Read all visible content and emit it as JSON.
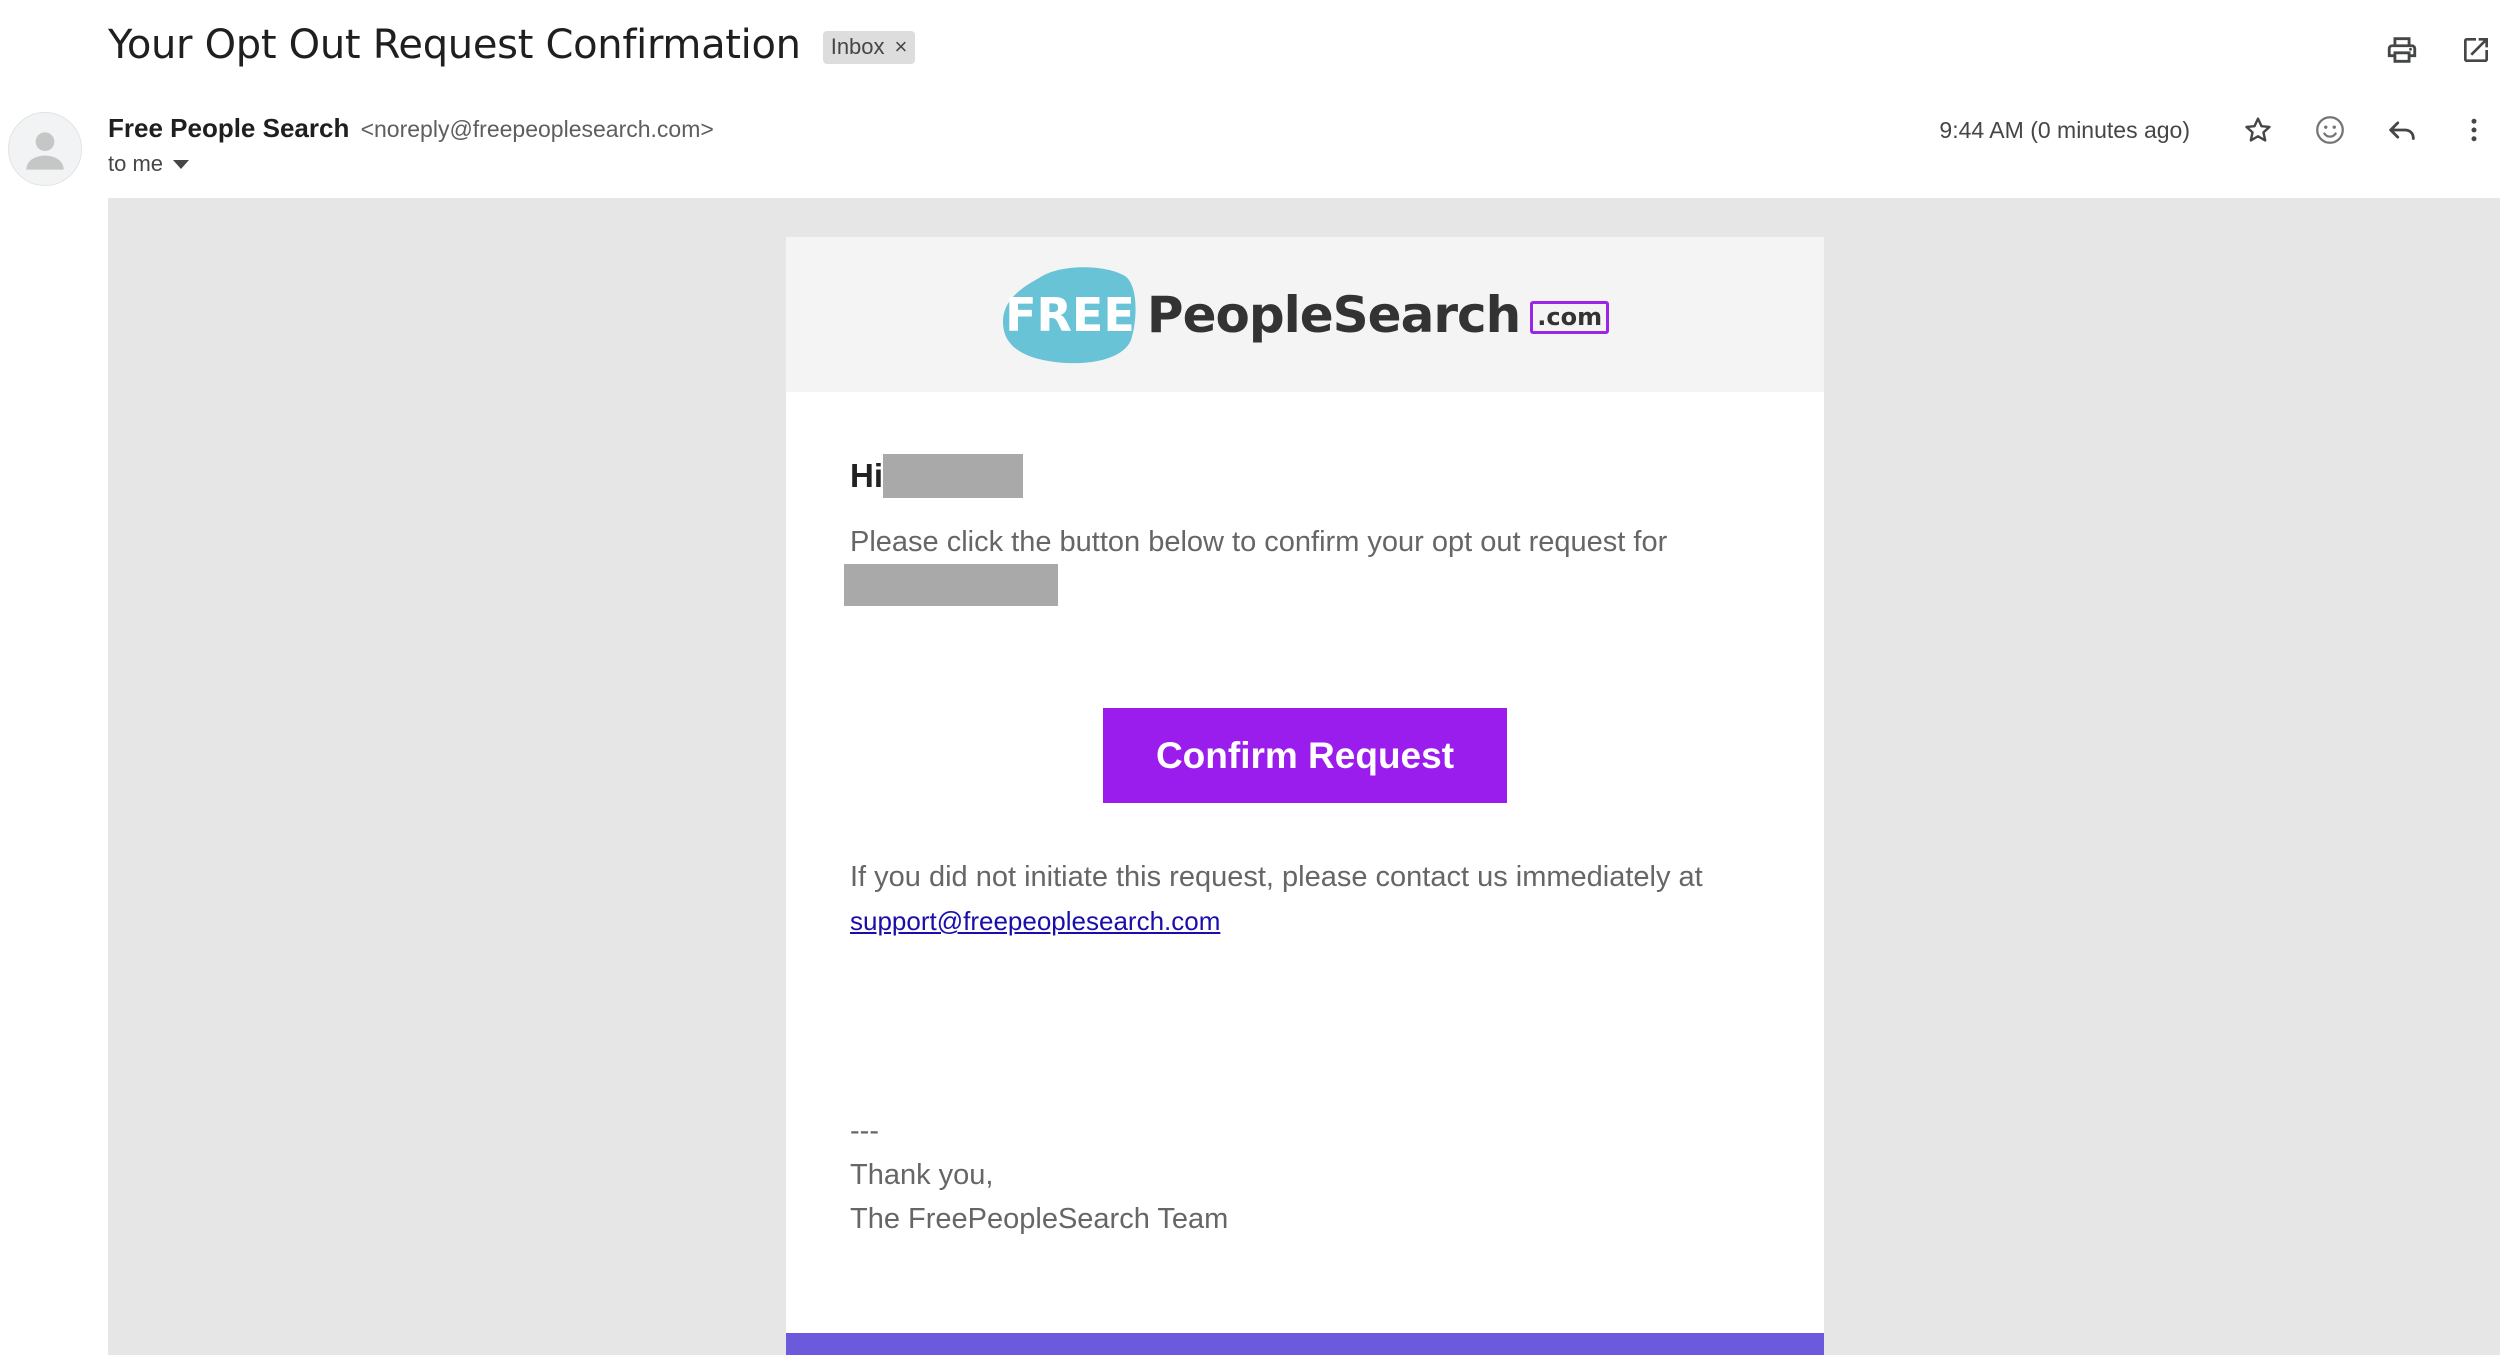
{
  "subject": {
    "title": "Your Opt Out Request Confirmation",
    "label": "Inbox",
    "label_remove": "×"
  },
  "top_actions": {
    "print_icon": "print-icon",
    "open_new_window_icon": "open-in-new-icon"
  },
  "sender": {
    "name": "Free People Search",
    "email": "<noreply@freepeoplesearch.com>",
    "to": "to me"
  },
  "meta": {
    "timestamp": "9:44 AM (0 minutes ago)",
    "icons": [
      "star-icon",
      "emoji-icon",
      "reply-icon",
      "more-vert-icon"
    ]
  },
  "email": {
    "logo": {
      "free": "FREE",
      "name": "PeopleSearch",
      "tld": ".com",
      "blob_color": "#69c3d6",
      "tld_border_color": "#9b26e8"
    },
    "greeting": "Hi",
    "body_line1": "Please click the button below to confirm your opt out request for",
    "confirm_button": "Confirm Request",
    "body_line2": "If you did not initiate this request, please contact us immediately at",
    "support_email": "support@freepeoplesearch.com",
    "signoff_separator": "---",
    "signoff_thanks": "Thank you,",
    "signoff_team": "The FreePeopleSearch Team"
  },
  "colors": {
    "button": "#9b1ded",
    "footer_bar": "#6b5bdc",
    "link": "#1a0dab",
    "redaction": "#a9a9a9"
  }
}
